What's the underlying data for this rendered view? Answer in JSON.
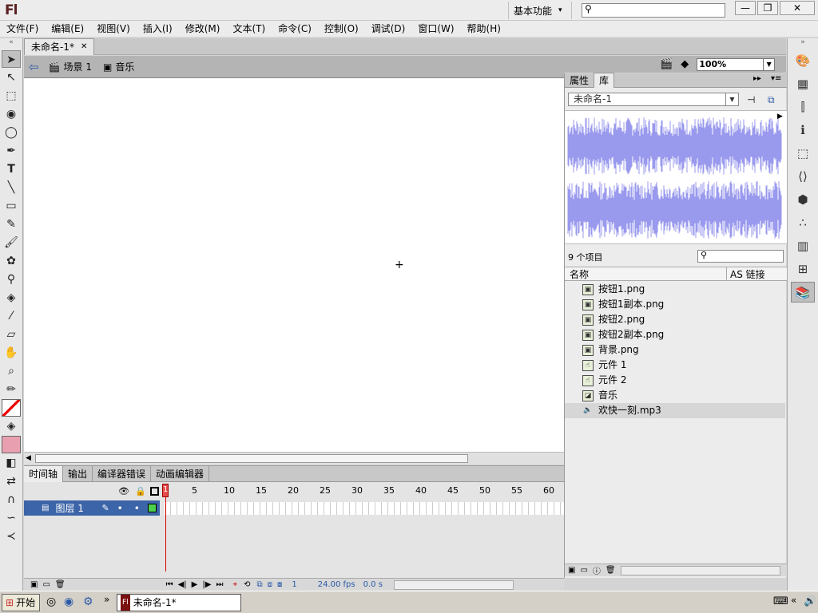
{
  "app": {
    "logo": "Fl",
    "workspace": "基本功能"
  },
  "menu": [
    "文件(F)",
    "编辑(E)",
    "视图(V)",
    "插入(I)",
    "修改(M)",
    "文本(T)",
    "命令(C)",
    "控制(O)",
    "调试(D)",
    "窗口(W)",
    "帮助(H)"
  ],
  "document": {
    "tab": "未命名-1*",
    "scene": "场景 1",
    "symbol": "音乐",
    "zoom": "100%"
  },
  "library": {
    "tabs": [
      "属性",
      "库"
    ],
    "active_tab": "库",
    "selector": "未命名-1",
    "count": "9 个项目",
    "columns": {
      "name": "名称",
      "linkage": "AS 链接"
    },
    "items": [
      {
        "name": "按钮1.png",
        "icon": "bitmap-icon"
      },
      {
        "name": "按钮1副本.png",
        "icon": "bitmap-icon"
      },
      {
        "name": "按钮2.png",
        "icon": "bitmap-icon"
      },
      {
        "name": "按钮2副本.png",
        "icon": "bitmap-icon"
      },
      {
        "name": "背景.png",
        "icon": "bitmap-icon"
      },
      {
        "name": "元件 1",
        "icon": "button-symbol-icon"
      },
      {
        "name": "元件 2",
        "icon": "button-symbol-icon"
      },
      {
        "name": "音乐",
        "icon": "graphic-symbol-icon"
      },
      {
        "name": "欢快一刻.mp3",
        "icon": "sound-icon"
      }
    ],
    "selected_index": 8
  },
  "timeline": {
    "tabs": [
      "时间轴",
      "输出",
      "编译器错误",
      "动画编辑器"
    ],
    "active_tab": "时间轴",
    "frame_numbers": [
      "1",
      "5",
      "10",
      "15",
      "20",
      "25",
      "30",
      "35",
      "40",
      "45",
      "50",
      "55",
      "60"
    ],
    "layer": "图层 1",
    "status": {
      "frame": "1",
      "fps": "24.00 fps",
      "time": "0.0 s"
    }
  },
  "taskbar": {
    "start": "开始",
    "window": "未命名-1*"
  },
  "colors": {
    "layer_highlight": "#3c64a8",
    "waveform": "#9999ee",
    "playhead": "#d00000"
  }
}
